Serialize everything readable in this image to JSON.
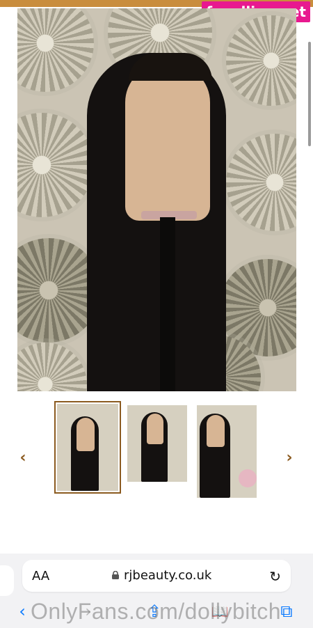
{
  "watermark": {
    "text": "fapellino.net"
  },
  "gallery": {
    "main_image": "wig-on-mannequin-photo",
    "thumbnails": [
      {
        "label": "thumbnail-1",
        "selected": true
      },
      {
        "label": "thumbnail-2",
        "selected": false
      },
      {
        "label": "thumbnail-3",
        "selected": false
      }
    ],
    "prev_icon": "‹",
    "next_icon": "›"
  },
  "browser": {
    "reader_label": "AA",
    "domain": "rjbeauty.co.uk",
    "reload_icon": "↻",
    "toolbar": {
      "back_icon": "‹",
      "forward_icon": "›",
      "share_icon": "⇪",
      "bookmarks_icon": "📖",
      "tabs_icon": "⧉"
    }
  },
  "overlay": {
    "text": "OnlyFans.com/dollybitch"
  },
  "colors": {
    "accent": "#8b5a1f",
    "ios_blue": "#0a7aff",
    "watermark_bg": "#e8198f"
  }
}
